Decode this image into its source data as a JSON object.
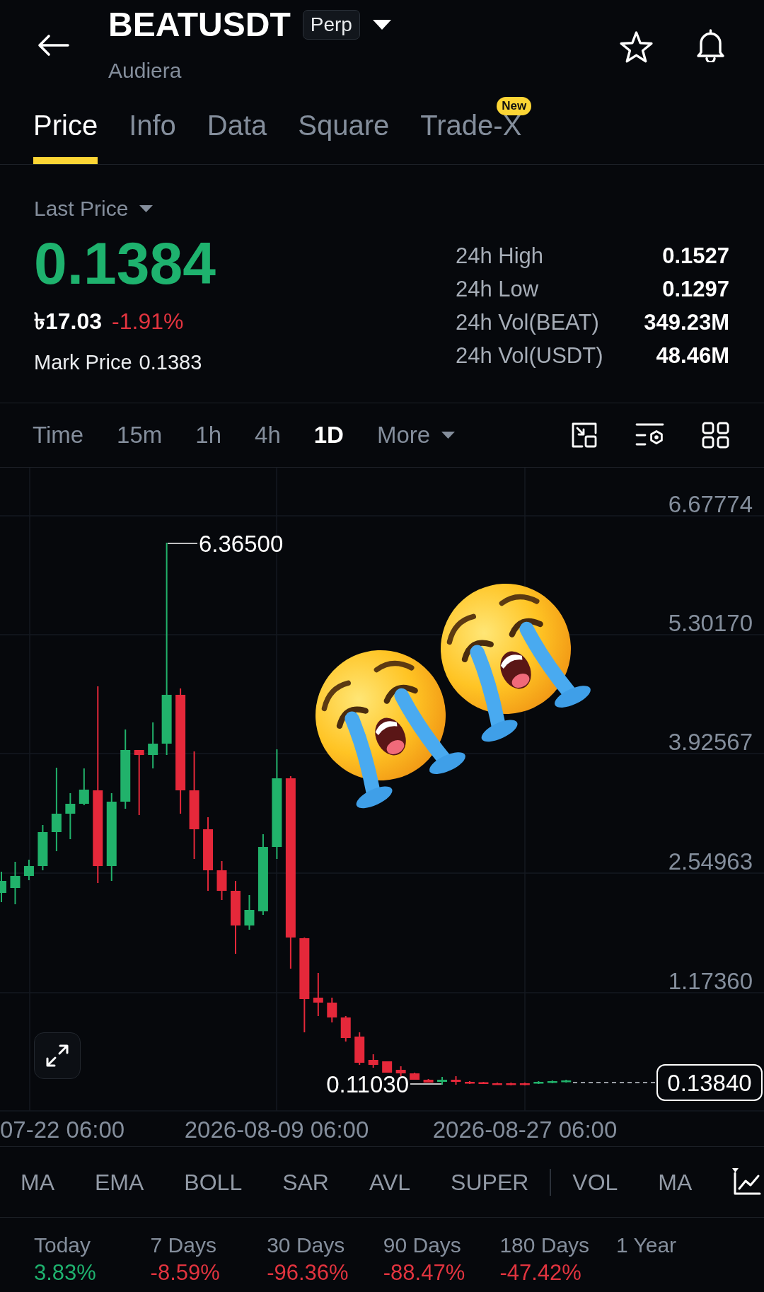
{
  "header": {
    "symbol": "BEATUSDT",
    "contract_badge": "Perp",
    "name": "Audiera"
  },
  "tabs": [
    {
      "label": "Price",
      "selected": true
    },
    {
      "label": "Info",
      "selected": false
    },
    {
      "label": "Data",
      "selected": false
    },
    {
      "label": "Square",
      "selected": false
    },
    {
      "label": "Trade-X",
      "selected": false,
      "badge": "New"
    }
  ],
  "price_panel": {
    "price_type": "Last Price",
    "last_price": {
      "value": "0.1384",
      "rising": true
    },
    "local_price": "৳17.03",
    "change": {
      "value": "-1.91%",
      "rising": false
    },
    "mark_price": {
      "label": "Mark Price",
      "value": "0.1383"
    },
    "stats": [
      {
        "label": "24h High",
        "value": "0.1527"
      },
      {
        "label": "24h Low",
        "value": "0.1297"
      },
      {
        "label": "24h Vol(BEAT)",
        "value": "349.23M"
      },
      {
        "label": "24h Vol(USDT)",
        "value": "48.46M"
      }
    ]
  },
  "intervals": [
    {
      "label": "Time",
      "kind": "option",
      "selected": false
    },
    {
      "label": "15m",
      "kind": "option",
      "selected": false
    },
    {
      "label": "1h",
      "kind": "option",
      "selected": false
    },
    {
      "label": "4h",
      "kind": "option",
      "selected": false
    },
    {
      "label": "1D",
      "kind": "option",
      "selected": true
    },
    {
      "label": "More",
      "kind": "menu",
      "selected": false
    }
  ],
  "chart": {
    "price_labels": [
      "6.67774",
      "5.30170",
      "3.92567",
      "2.54963",
      "1.17360"
    ],
    "time_labels": [
      "07-22 06:00",
      "2026-08-09 06:00",
      "2026-08-27 06:00"
    ],
    "high_label": "6.36500",
    "low_label": "0.11030",
    "last_price_tag": "0.13840"
  },
  "indicator_groups": [
    [
      "MA",
      "EMA",
      "BOLL",
      "SAR",
      "AVL",
      "SUPER"
    ],
    [
      "VOL",
      "MA"
    ]
  ],
  "performance": [
    {
      "label": "Today",
      "value": "3.83%",
      "rising": true
    },
    {
      "label": "7 Days",
      "value": "-8.59%",
      "rising": false
    },
    {
      "label": "30 Days",
      "value": "-96.36%",
      "rising": false
    },
    {
      "label": "90 Days",
      "value": "-88.47%",
      "rising": false
    },
    {
      "label": "180 Days",
      "value": "-47.42%",
      "rising": false
    },
    {
      "label": "1 Year"
    }
  ]
}
